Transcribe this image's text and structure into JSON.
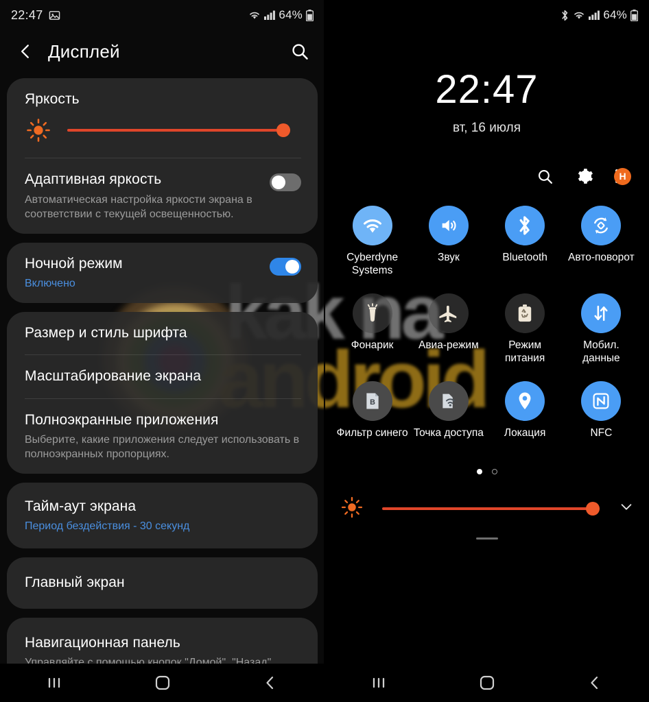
{
  "left": {
    "status_bar": {
      "time": "22:47",
      "battery_percent": "64%",
      "icons": [
        "image-icon",
        "wifi-icon",
        "signal-icon",
        "battery-icon"
      ]
    },
    "header": {
      "back_icon": "chevron-left-icon",
      "title": "Дисплей",
      "search_icon": "search-icon"
    },
    "brightness": {
      "title": "Яркость",
      "sun_icon": "brightness-sun-icon",
      "value_percent": 100
    },
    "adaptive": {
      "title": "Адаптивная яркость",
      "subtitle": "Автоматическая настройка яркости экрана в соответствии с текущей освещенностью.",
      "toggle_state": "off"
    },
    "night_mode": {
      "title": "Ночной режим",
      "subtitle": "Включено",
      "toggle_state": "on"
    },
    "font_size": {
      "title": "Размер и стиль шрифта"
    },
    "screen_zoom": {
      "title": "Масштабирование экрана"
    },
    "fullscreen_apps": {
      "title": "Полноэкранные приложения",
      "subtitle": "Выберите, какие приложения следует использовать в полноэкранных пропорциях."
    },
    "screen_timeout": {
      "title": "Тайм-аут экрана",
      "subtitle": "Период бездействия - 30 секунд"
    },
    "home_screen": {
      "title": "Главный экран"
    },
    "nav_bar_setting": {
      "title": "Навигационная панель",
      "subtitle": "Управляйте с помощью кнопок \"Домой\", \"Назад\""
    },
    "navbar": {
      "recents_icon": "recent-apps-icon",
      "home_icon": "home-icon",
      "back_icon": "back-icon"
    }
  },
  "right": {
    "status_bar": {
      "battery_percent": "64%",
      "icons": [
        "bluetooth-icon",
        "wifi-icon",
        "signal-icon",
        "battery-icon"
      ]
    },
    "clock": {
      "time": "22:47",
      "date": "вт, 16 июля"
    },
    "actions": {
      "search_icon": "search-icon",
      "settings_icon": "gear-icon",
      "more_icon": "more-vertical-icon",
      "avatar_label": "H"
    },
    "tiles": [
      {
        "label": "Cyberdyne Systems",
        "icon": "wifi-icon",
        "state": "on"
      },
      {
        "label": "Звук",
        "icon": "sound-icon",
        "state": "on"
      },
      {
        "label": "Bluetooth",
        "icon": "bluetooth-icon",
        "state": "on"
      },
      {
        "label": "Авто-поворот",
        "icon": "auto-rotate-icon",
        "state": "on"
      },
      {
        "label": "Фонарик",
        "icon": "flashlight-icon",
        "state": "off"
      },
      {
        "label": "Авиа-режим",
        "icon": "airplane-icon",
        "state": "off"
      },
      {
        "label": "Режим питания",
        "icon": "power-mode-icon",
        "state": "off"
      },
      {
        "label": "Мобил. данные",
        "icon": "mobile-data-icon",
        "state": "on"
      },
      {
        "label": "Фильтр синего",
        "icon": "blue-filter-icon",
        "state": "off"
      },
      {
        "label": "Точка доступа",
        "icon": "hotspot-icon",
        "state": "off"
      },
      {
        "label": "Локация",
        "icon": "location-icon",
        "state": "on"
      },
      {
        "label": "NFC",
        "icon": "nfc-icon",
        "state": "on"
      }
    ],
    "pages": {
      "count": 2,
      "active_index": 0
    },
    "brightness": {
      "sun_icon": "brightness-sun-icon",
      "value_percent": 100,
      "expand_icon": "chevron-down-icon"
    },
    "navbar": {
      "recents_icon": "recent-apps-icon",
      "home_icon": "home-icon",
      "back_icon": "back-icon"
    }
  },
  "watermark": {
    "line1": "kak na",
    "line2": "android"
  },
  "colors": {
    "accent_orange": "#ef5a2b",
    "accent_blue": "#4a9df5",
    "toggle_on": "#2f86e8",
    "card_bg": "#2a2a2a",
    "link_blue": "#4a8fe0",
    "avatar_orange": "#ef6a1d"
  }
}
